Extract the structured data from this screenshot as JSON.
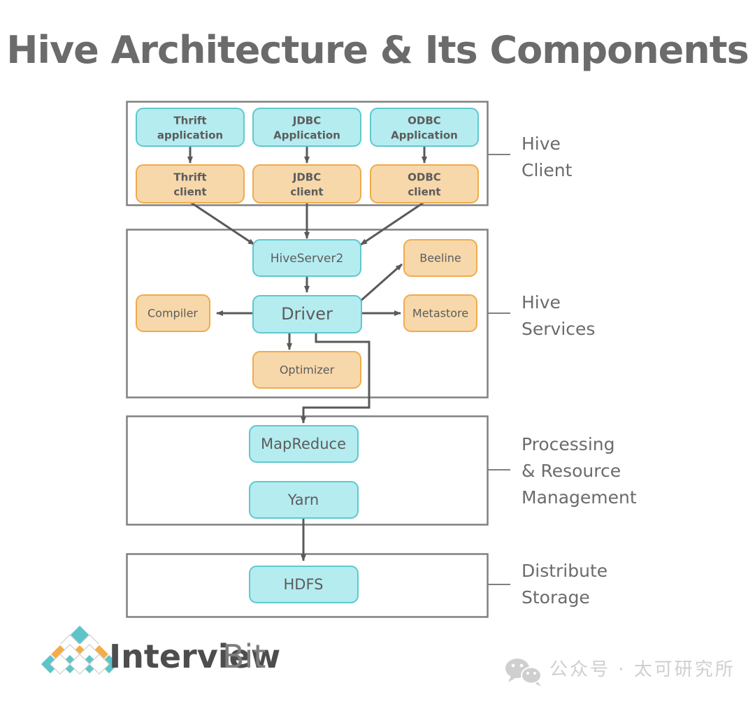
{
  "title": "Hive Architecture & Its Components",
  "colors": {
    "cyan_fill": "#b5ecf0",
    "cyan_stroke": "#5ec8cf",
    "orange_fill": "#f7d8ab",
    "orange_stroke": "#f0ab4b",
    "box_stroke": "#808080",
    "arrow": "#595959",
    "text": "#5c5c5c",
    "title": "#6b6b6b",
    "logo_teal": "#5fc4c9",
    "logo_orange": "#f4ac45",
    "logo_dark": "#4d4d4d",
    "logo_light": "#7d7d7d",
    "watermark": "#cfcfcf"
  },
  "sections": [
    {
      "id": "hive-client",
      "label_lines": [
        "Hive",
        "Client"
      ]
    },
    {
      "id": "hive-services",
      "label_lines": [
        "Hive",
        "Services"
      ]
    },
    {
      "id": "processing-resource-management",
      "label_lines": [
        "Processing",
        "& Resource",
        "Management"
      ]
    },
    {
      "id": "distribute-storage",
      "label_lines": [
        "Distribute",
        "Storage"
      ]
    }
  ],
  "nodes": {
    "thrift_application": {
      "lines": [
        "Thrift",
        "application"
      ],
      "color": "cyan"
    },
    "jdbc_application": {
      "lines": [
        "JDBC",
        "Application"
      ],
      "color": "cyan"
    },
    "odbc_application": {
      "lines": [
        "ODBC",
        "Application"
      ],
      "color": "cyan"
    },
    "thrift_client": {
      "lines": [
        "Thrift",
        "client"
      ],
      "color": "orange"
    },
    "jdbc_client": {
      "lines": [
        "JDBC",
        "client"
      ],
      "color": "orange"
    },
    "odbc_client": {
      "lines": [
        "ODBC",
        "client"
      ],
      "color": "orange"
    },
    "hiveserver2": {
      "lines": [
        "HiveServer2"
      ],
      "color": "cyan"
    },
    "beeline": {
      "lines": [
        "Beeline"
      ],
      "color": "orange"
    },
    "compiler": {
      "lines": [
        "Compiler"
      ],
      "color": "orange"
    },
    "driver": {
      "lines": [
        "Driver"
      ],
      "color": "cyan"
    },
    "metastore": {
      "lines": [
        "Metastore"
      ],
      "color": "orange"
    },
    "optimizer": {
      "lines": [
        "Optimizer"
      ],
      "color": "orange"
    },
    "mapreduce": {
      "lines": [
        "MapReduce"
      ],
      "color": "cyan"
    },
    "yarn": {
      "lines": [
        "Yarn"
      ],
      "color": "cyan"
    },
    "hdfs": {
      "lines": [
        "HDFS"
      ],
      "color": "cyan"
    }
  },
  "logo": {
    "name_bold": "Interview",
    "name_light": "Bit"
  },
  "watermark": {
    "icon": "wechat-icon",
    "text": "公众号 · 太可研究所"
  }
}
